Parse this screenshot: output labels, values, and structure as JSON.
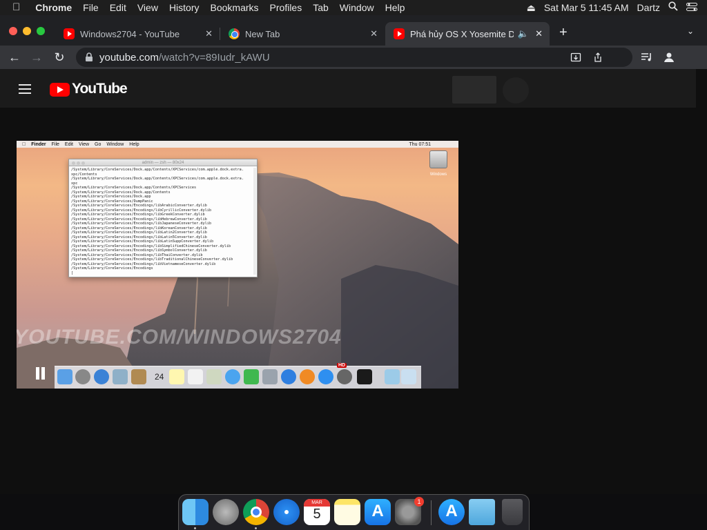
{
  "menubar": {
    "app_name": "Chrome",
    "menus": [
      "File",
      "Edit",
      "View",
      "History",
      "Bookmarks",
      "Profiles",
      "Tab",
      "Window",
      "Help"
    ],
    "datetime": "Sat Mar 5  11:45 AM",
    "user": "Dartz"
  },
  "tabs": [
    {
      "title": "Windows2704 - YouTube"
    },
    {
      "title": "New Tab"
    },
    {
      "title": "Phá hủy OS X Yosemite DP"
    }
  ],
  "toolbar": {
    "url_host": "youtube.com",
    "url_path": "/watch?v=89Iudr_kAWU"
  },
  "youtube": {
    "logo_text": "YouTube"
  },
  "video": {
    "finder_menus": [
      "Finder",
      "File",
      "Edit",
      "View",
      "Go",
      "Window",
      "Help"
    ],
    "clock": "Thu 07:51",
    "terminal_title": "admin — zsh — 80x24",
    "terminal_lines": [
      "/System/Library/CoreServices/Dock.app/Contents/XPCServices/com.apple.dock.extra.",
      "xpc/Contents",
      "/System/Library/CoreServices/Dock.app/Contents/XPCServices/com.apple.dock.extra.",
      "xpc",
      "/System/Library/CoreServices/Dock.app/Contents/XPCServices",
      "/System/Library/CoreServices/Dock.app/Contents",
      "/System/Library/CoreServices/Dock.app",
      "/System/Library/CoreServices/DumpPanic",
      "/System/Library/CoreServices/Encodings/libArabicConverter.dylib",
      "/System/Library/CoreServices/Encodings/libCyrillicConverter.dylib",
      "/System/Library/CoreServices/Encodings/libGreekConverter.dylib",
      "/System/Library/CoreServices/Encodings/libHebrewConverter.dylib",
      "/System/Library/CoreServices/Encodings/libJapaneseConverter.dylib",
      "/System/Library/CoreServices/Encodings/libKoreanConverter.dylib",
      "/System/Library/CoreServices/Encodings/libLatin2Converter.dylib",
      "/System/Library/CoreServices/Encodings/libLatin5Converter.dylib",
      "/System/Library/CoreServices/Encodings/libLatinSuppConverter.dylib",
      "/System/Library/CoreServices/Encodings/libSimplifiedChineseConverter.dylib",
      "/System/Library/CoreServices/Encodings/libSymbolConverter.dylib",
      "/System/Library/CoreServices/Encodings/libThaiConverter.dylib",
      "/System/Library/CoreServices/Encodings/libTraditionalChineseConverter.dylib",
      "/System/Library/CoreServices/Encodings/libVietnameseConverter.dylib",
      "/System/Library/CoreServices/Encodings",
      "["
    ],
    "disk_label": "Windows",
    "watermark": "YOUTUBE.COM/WINDOWS2704",
    "dock_calendar_day": "24",
    "hd_badge": "HD"
  },
  "dock": {
    "calendar_month": "MAR",
    "calendar_day": "5",
    "settings_badge": "1",
    "items": [
      "finder-icon",
      "launchpad-icon",
      "chrome-icon",
      "safari-icon",
      "calendar-icon",
      "notes-icon",
      "app-store-icon",
      "system-preferences-icon",
      "app-store-download-icon",
      "downloads-folder-icon",
      "trash-icon"
    ]
  },
  "colors": {
    "youtube_red": "#ff0000",
    "chrome_tab_active": "#35363a",
    "chrome_tabstrip": "#202124"
  }
}
